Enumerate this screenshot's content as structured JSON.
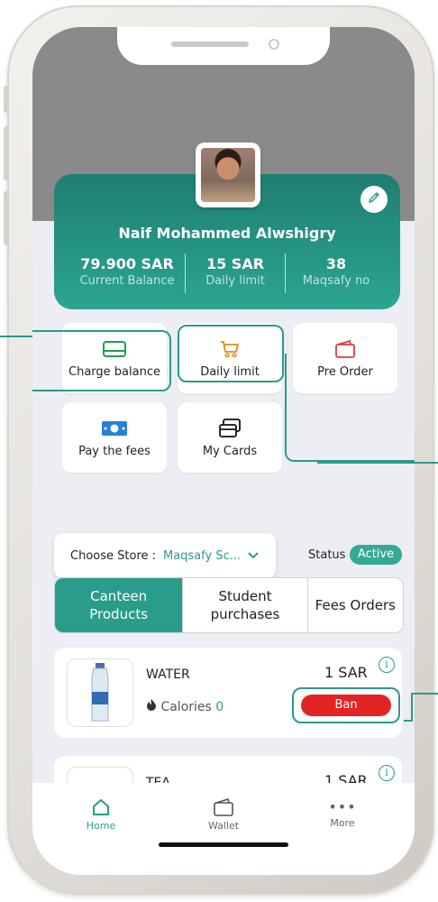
{
  "profile": {
    "name": "Naif Mohammed Alwshigry",
    "stats": [
      {
        "value": "79.900 SAR",
        "label": "Current Balance"
      },
      {
        "value": "15 SAR",
        "label": "Daily limit"
      },
      {
        "value": "38",
        "label": "Maqsafy no"
      }
    ]
  },
  "actions": {
    "charge_balance": "Charge balance",
    "daily_limit": "Daily limit",
    "pre_order": "Pre Order",
    "pay_fees": "Pay the fees",
    "my_cards": "My Cards"
  },
  "store": {
    "label": "Choose Store :",
    "value": "Maqsafy Sc...",
    "status_label": "Status",
    "status_value": "Active"
  },
  "tabs": [
    {
      "label": "Canteen Products",
      "active": true
    },
    {
      "label": "Student purchases",
      "active": false
    },
    {
      "label": "Fees Orders",
      "active": false
    }
  ],
  "products": [
    {
      "name": "WATER",
      "calories_label": "Calories",
      "calories": "0",
      "price": "1 SAR",
      "action": "Ban"
    },
    {
      "name": "TEA",
      "price": "1 SAR"
    }
  ],
  "nav": {
    "home": "Home",
    "wallet": "Wallet",
    "more": "More"
  },
  "colors": {
    "accent": "#2a9c8a",
    "ban": "#e32424",
    "header_gray": "#8a8a8a"
  }
}
